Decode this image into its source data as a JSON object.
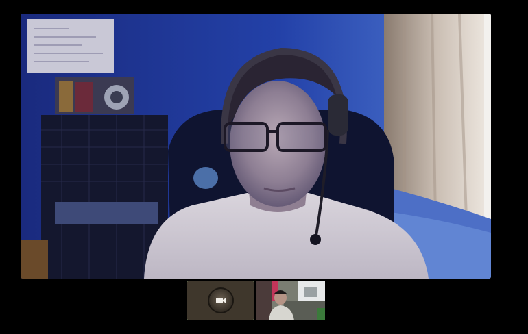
{
  "call": {
    "main_video": {
      "description_icon": "video-feed"
    },
    "thumbnails": [
      {
        "kind": "self",
        "camera_state": "off",
        "icon": "video-camera-icon",
        "selected": true
      },
      {
        "kind": "participant",
        "camera_state": "on",
        "icon": "video-feed"
      }
    ]
  },
  "colors": {
    "background": "#000000",
    "selected_border": "#8ed08a",
    "self_tile": "#3f372c"
  }
}
